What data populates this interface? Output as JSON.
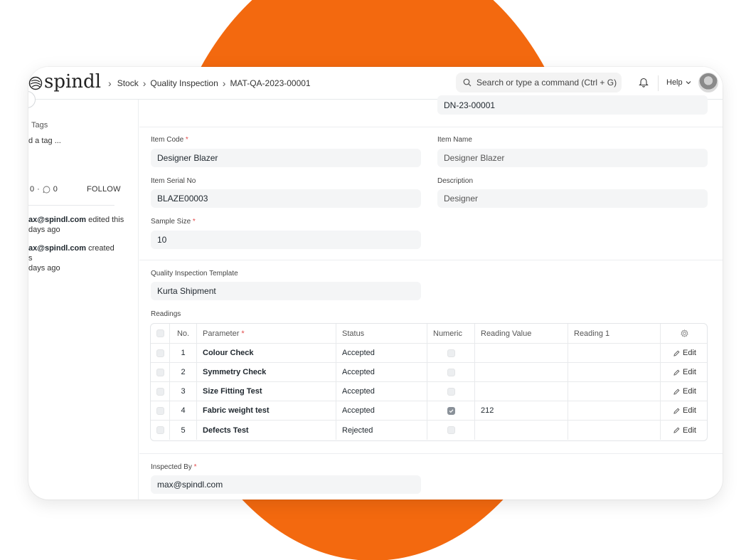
{
  "app": {
    "logo_text": "spindl"
  },
  "breadcrumbs": [
    "Stock",
    "Quality Inspection",
    "MAT-QA-2023-00001"
  ],
  "search": {
    "placeholder": "Search or type a command (Ctrl + G)"
  },
  "header": {
    "help_label": "Help"
  },
  "sidebar": {
    "tags_label": "Tags",
    "add_tag": "d a tag ...",
    "likes_count": "0",
    "comments_count": "0",
    "follow_label": "FOLLOW",
    "activity": [
      {
        "user": "ax@spindl.com",
        "action": " edited this",
        "time": "days ago"
      },
      {
        "user": "ax@spindl.com",
        "action": " created",
        "extra": "s",
        "time": "days ago"
      }
    ]
  },
  "form": {
    "reference_value": "DN-23-00001",
    "item_code": {
      "label": "Item Code",
      "value": "Designer Blazer"
    },
    "item_name": {
      "label": "Item Name",
      "value": "Designer Blazer"
    },
    "item_serial_no": {
      "label": "Item Serial No",
      "value": "BLAZE00003"
    },
    "description": {
      "label": "Description",
      "value": "Designer"
    },
    "sample_size": {
      "label": "Sample Size",
      "value": "10"
    },
    "template": {
      "label": "Quality Inspection Template",
      "value": "Kurta Shipment"
    },
    "readings_label": "Readings",
    "inspected_by": {
      "label": "Inspected By",
      "value": "max@spindl.com"
    },
    "required_mark": "*"
  },
  "readings": {
    "columns": {
      "no": "No.",
      "parameter": "Parameter",
      "status": "Status",
      "numeric": "Numeric",
      "reading_value": "Reading Value",
      "reading_1": "Reading 1"
    },
    "edit_label": "Edit",
    "rows": [
      {
        "no": "1",
        "parameter": "Colour Check",
        "status": "Accepted",
        "numeric": false,
        "reading_value": ""
      },
      {
        "no": "2",
        "parameter": "Symmetry Check",
        "status": "Accepted",
        "numeric": false,
        "reading_value": ""
      },
      {
        "no": "3",
        "parameter": "Size Fitting Test",
        "status": "Accepted",
        "numeric": false,
        "reading_value": ""
      },
      {
        "no": "4",
        "parameter": "Fabric weight test",
        "status": "Accepted",
        "numeric": true,
        "reading_value": "212"
      },
      {
        "no": "5",
        "parameter": "Defects Test",
        "status": "Rejected",
        "numeric": false,
        "reading_value": ""
      }
    ]
  },
  "colors": {
    "accent": "#f3690f",
    "required": "#e24c4c",
    "field_bg": "#f4f5f6"
  }
}
